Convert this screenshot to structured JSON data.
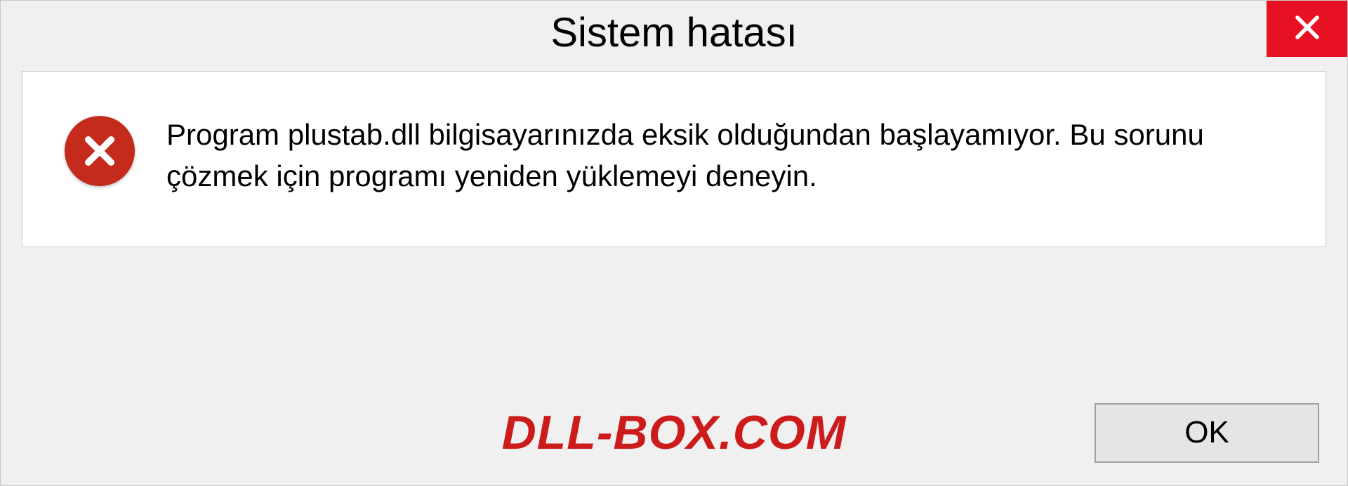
{
  "dialog": {
    "title": "Sistem hatası",
    "message": "Program plustab.dll bilgisayarınızda eksik olduğundan başlayamıyor. Bu sorunu çözmek için programı yeniden yüklemeyi deneyin.",
    "ok_label": "OK"
  },
  "watermark": "DLL-BOX.COM",
  "icons": {
    "close": "close-icon",
    "error": "error-icon"
  },
  "colors": {
    "close_button_bg": "#e81123",
    "error_icon_bg": "#c42b1c",
    "watermark_color": "#cc1b1b",
    "panel_bg": "#f0f0f0"
  }
}
